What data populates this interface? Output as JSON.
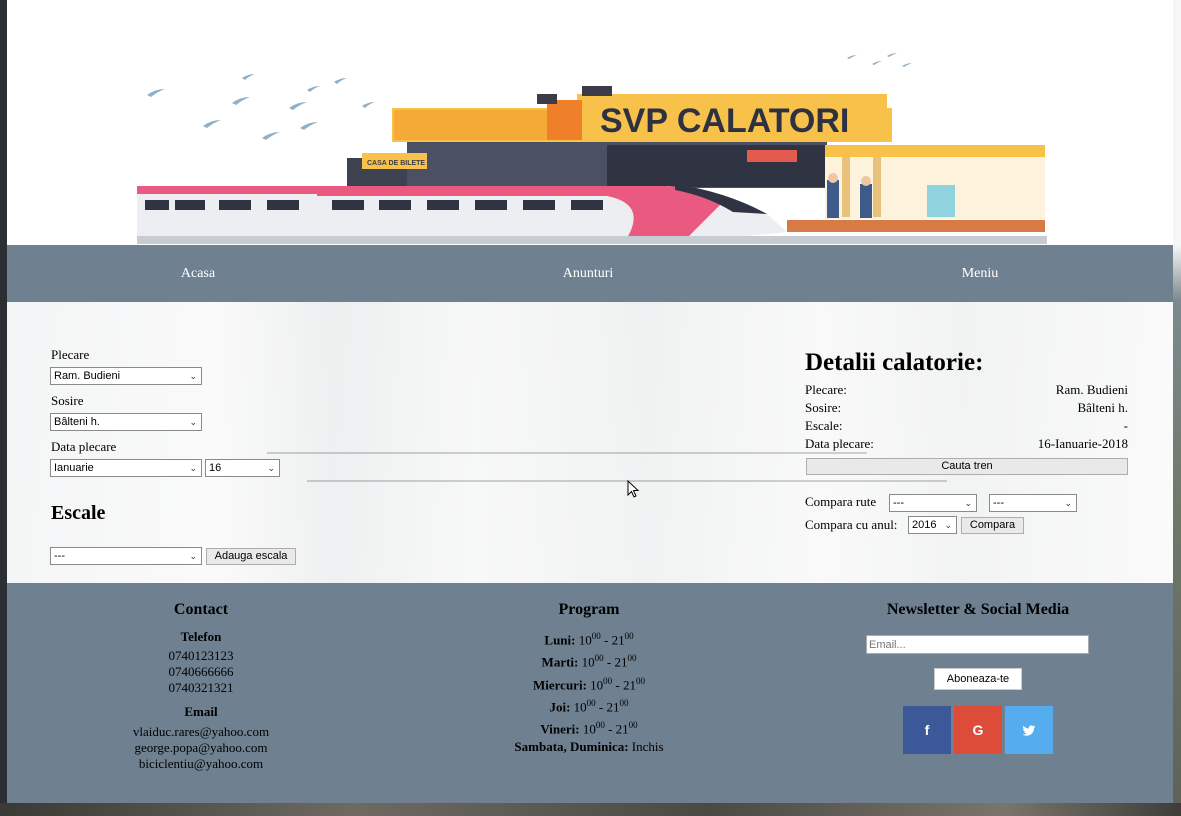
{
  "banner": {
    "logo_text": "SVP CALATORI",
    "ticket_sign": "CASA DE BILETE"
  },
  "nav": {
    "items": [
      "Acasa",
      "Anunturi",
      "Meniu"
    ]
  },
  "form": {
    "departure_label": "Plecare",
    "departure_value": "Ram. Budieni",
    "arrival_label": "Sosire",
    "arrival_value": "Bâlteni h.",
    "date_label": "Data plecare",
    "month_value": "Ianuarie",
    "day_value": "16",
    "stops_heading": "Escale",
    "stops_value": "---",
    "add_stop_button": "Adauga escala"
  },
  "details": {
    "title": "Detalii calatorie:",
    "rows": [
      {
        "key": "Plecare:",
        "value": "Ram. Budieni"
      },
      {
        "key": "Sosire:",
        "value": "Bâlteni h."
      },
      {
        "key": "Escale:",
        "value": "-"
      },
      {
        "key": "Data plecare:",
        "value": "16-Ianuarie-2018"
      }
    ],
    "search_button": "Cauta tren",
    "compare_routes_label": "Compara rute",
    "compare_route_1": "---",
    "compare_route_2": "---",
    "compare_year_label": "Compara cu anul:",
    "compare_year_value": "2016",
    "compare_button": "Compara"
  },
  "footer": {
    "contact": {
      "heading": "Contact",
      "phone_heading": "Telefon",
      "phones": [
        "0740123123",
        "0740666666",
        "0740321321"
      ],
      "email_heading": "Email",
      "emails": [
        "vlaiduc.rares@yahoo.com",
        "george.popa@yahoo.com",
        "biciclentiu@yahoo.com"
      ]
    },
    "program": {
      "heading": "Program",
      "days": [
        {
          "day": "Luni:",
          "open": "10",
          "open_sup": "00",
          "close": "21",
          "close_sup": "00"
        },
        {
          "day": "Marti:",
          "open": "10",
          "open_sup": "00",
          "close": "21",
          "close_sup": "00"
        },
        {
          "day": "Miercuri:",
          "open": "10",
          "open_sup": "00",
          "close": "21",
          "close_sup": "00"
        },
        {
          "day": "Joi:",
          "open": "10",
          "open_sup": "00",
          "close": "21",
          "close_sup": "00"
        },
        {
          "day": "Vineri:",
          "open": "10",
          "open_sup": "00",
          "close": "21",
          "close_sup": "00"
        }
      ],
      "weekend_day": "Sambata, Duminica:",
      "weekend_value": "Inchis"
    },
    "newsletter": {
      "heading": "Newsletter & Social Media",
      "email_placeholder": "Email...",
      "subscribe_button": "Aboneaza-te",
      "social": [
        {
          "icon": "facebook-icon",
          "glyph": "f",
          "color": "#3b5998"
        },
        {
          "icon": "google-icon",
          "glyph": "G",
          "color": "#dd4b39"
        },
        {
          "icon": "twitter-icon",
          "glyph": "🐦",
          "color": "#55acee"
        }
      ]
    }
  },
  "colors": {
    "nav_bg": "#6f8091",
    "footer_bg": "#6f8091"
  }
}
